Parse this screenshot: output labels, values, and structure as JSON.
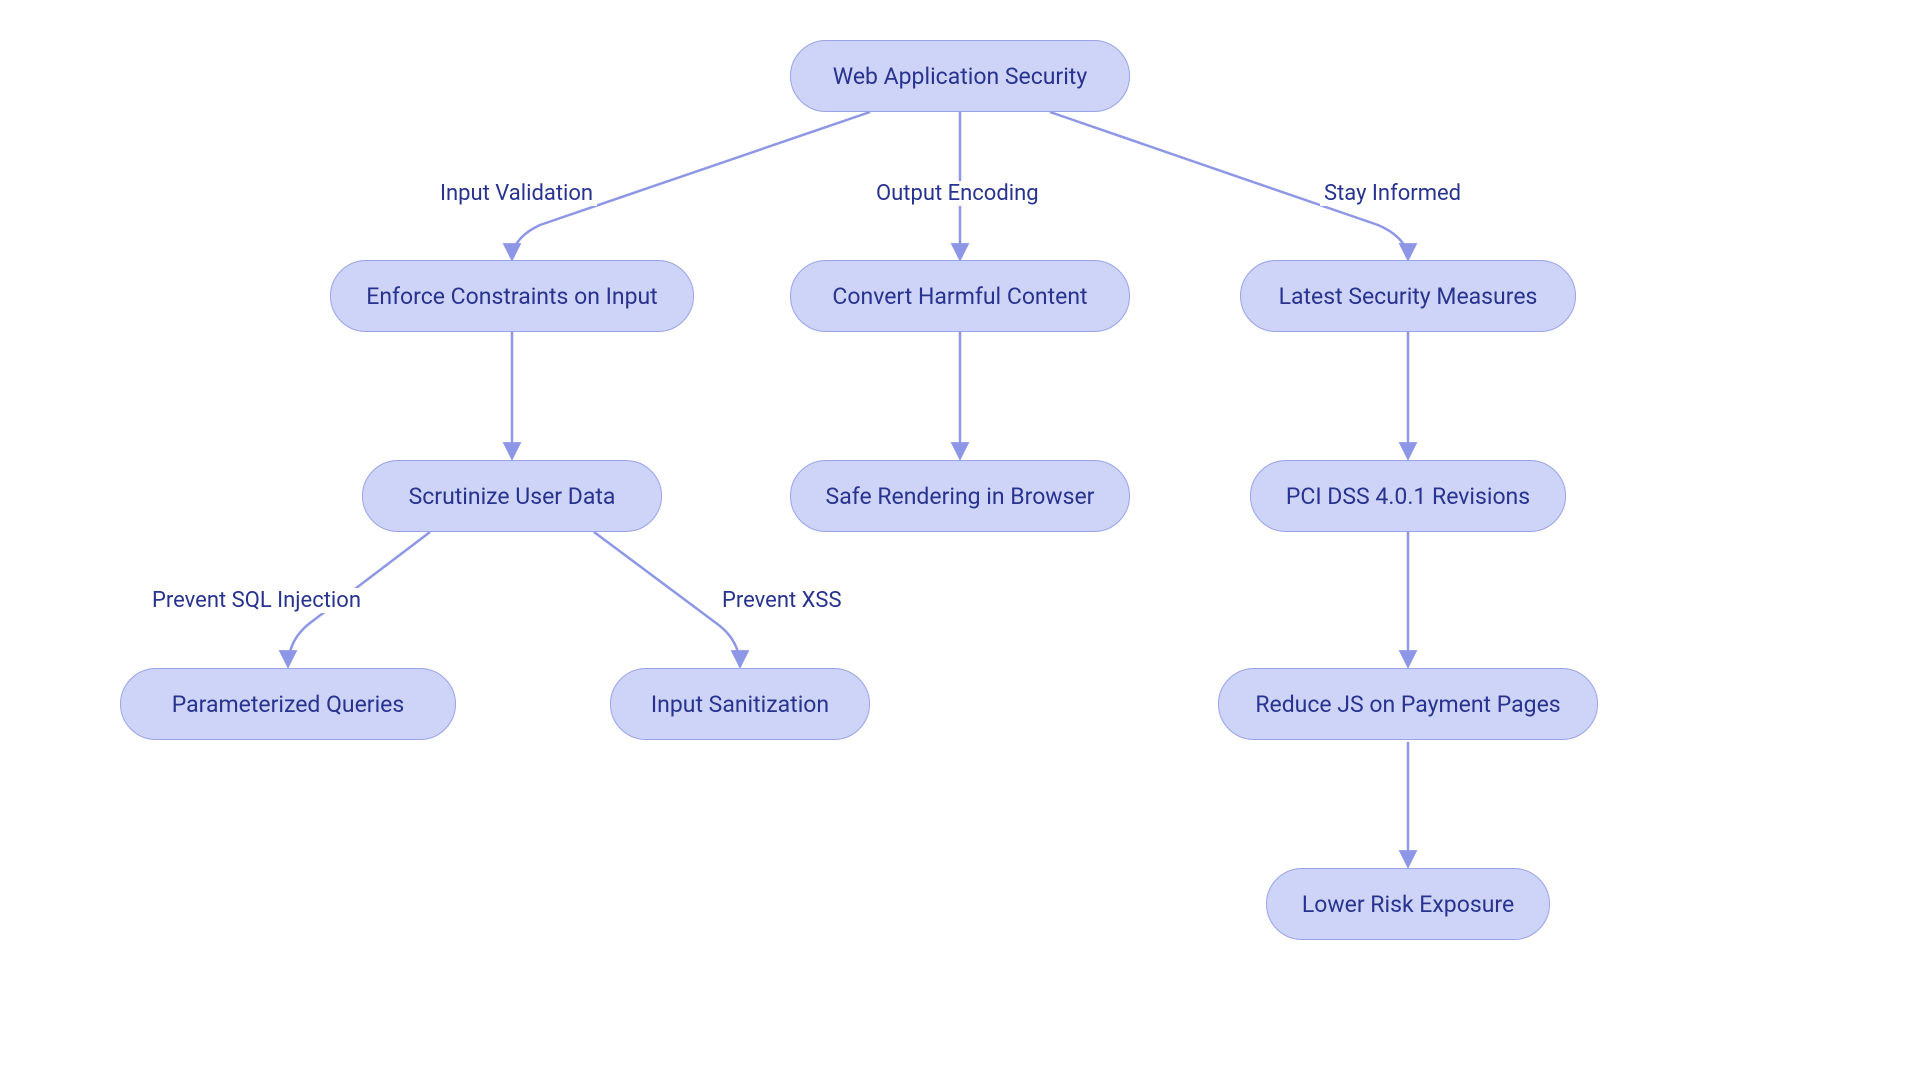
{
  "nodes": {
    "root": "Web Application Security",
    "enforce": "Enforce Constraints on Input",
    "scrutinize": "Scrutinize User Data",
    "param": "Parameterized Queries",
    "sanitize": "Input Sanitization",
    "convert": "Convert Harmful Content",
    "safe": "Safe Rendering in Browser",
    "latest": "Latest Security Measures",
    "pci": "PCI DSS 4.0.1 Revisions",
    "reduce": "Reduce JS on Payment Pages",
    "lower": "Lower Risk Exposure"
  },
  "edges": {
    "input_validation": "Input Validation",
    "output_encoding": "Output Encoding",
    "stay_informed": "Stay Informed",
    "prevent_sql": "Prevent SQL Injection",
    "prevent_xss": "Prevent XSS"
  },
  "colors": {
    "node_fill": "#ced4f7",
    "node_stroke": "#9aa3e8",
    "text": "#28338f",
    "edge": "#8d97e6"
  }
}
